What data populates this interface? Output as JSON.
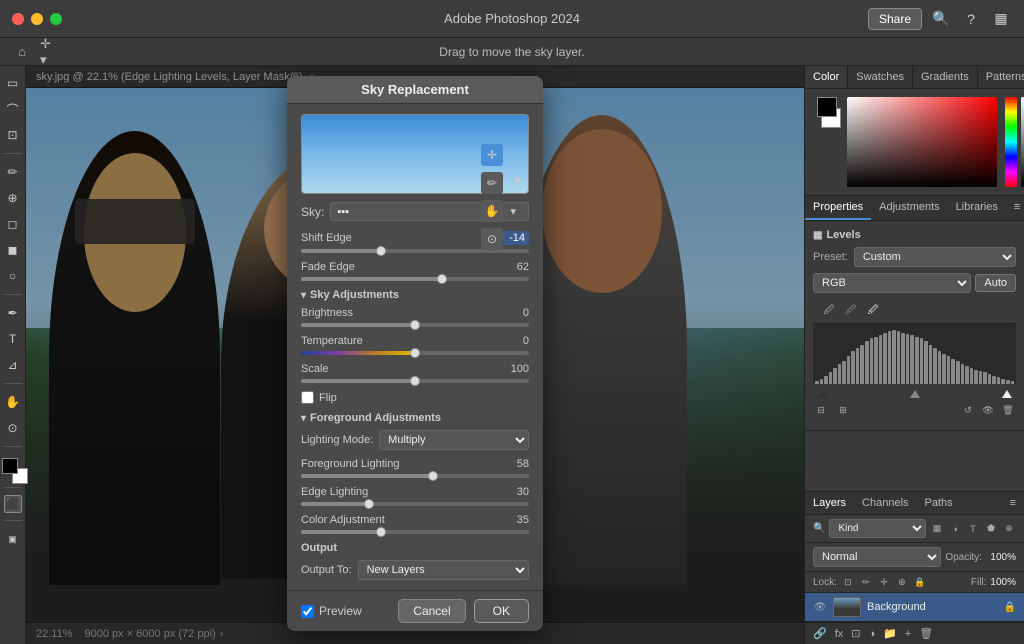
{
  "app": {
    "title": "Adobe Photoshop 2024",
    "subtitle": "Drag to move the sky layer.",
    "tab": "sky.jpg @ 22.1% (Edge Lighting Levels, Layer Mask/8)"
  },
  "titlebar": {
    "share_label": "Share"
  },
  "dialog": {
    "title": "Sky Replacement",
    "sky_label": "Sky:",
    "shift_edge_label": "Shift Edge",
    "shift_edge_value": "-14",
    "fade_edge_label": "Fade Edge",
    "fade_edge_value": "62",
    "sky_adjustments_label": "Sky Adjustments",
    "brightness_label": "Brightness",
    "brightness_value": "0",
    "temperature_label": "Temperature",
    "temperature_value": "0",
    "scale_label": "Scale",
    "scale_value": "100",
    "flip_label": "Flip",
    "foreground_adjustments_label": "Foreground Adjustments",
    "lighting_mode_label": "Lighting Mode:",
    "lighting_mode_value": "Multiply",
    "foreground_lighting_label": "Foreground Lighting",
    "foreground_lighting_value": "58",
    "edge_lighting_label": "Edge Lighting",
    "edge_lighting_value": "30",
    "color_adjustment_label": "Color Adjustment",
    "color_adjustment_value": "35",
    "output_label": "Output",
    "output_to_label": "Output To:",
    "output_to_value": "New Layers",
    "preview_label": "Preview",
    "cancel_label": "Cancel",
    "ok_label": "OK"
  },
  "color_panel": {
    "tabs": [
      "Color",
      "Swatches",
      "Gradients",
      "Patterns"
    ]
  },
  "properties_panel": {
    "tabs": [
      "Properties",
      "Adjustments",
      "Libraries"
    ],
    "section_title": "Levels",
    "preset_label": "Preset:",
    "preset_value": "Custom",
    "channel_value": "RGB",
    "auto_label": "Auto"
  },
  "layers_panel": {
    "tabs": [
      "Layers",
      "Channels",
      "Paths"
    ],
    "kind_placeholder": "Kind",
    "mode_value": "Normal",
    "opacity_label": "Opacity:",
    "opacity_value": "100%",
    "lock_label": "Lock:",
    "fill_label": "Fill:",
    "fill_value": "100%",
    "layer_name": "Background"
  },
  "statusbar": {
    "zoom": "22.11%",
    "info": "9000 px × 6000 px (72 ppi)"
  },
  "histogram_data": [
    5,
    8,
    12,
    18,
    25,
    30,
    35,
    42,
    50,
    55,
    60,
    65,
    70,
    72,
    75,
    78,
    80,
    82,
    80,
    78,
    76,
    74,
    72,
    70,
    65,
    60,
    55,
    50,
    45,
    42,
    38,
    35,
    30,
    28,
    25,
    22,
    20,
    18,
    15,
    12,
    10,
    8,
    6,
    5
  ]
}
